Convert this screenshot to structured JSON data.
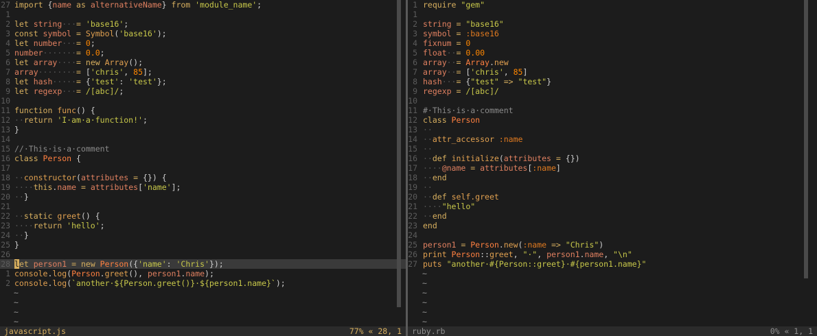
{
  "editor": {
    "left_pane": {
      "file_name": "javascript.js",
      "position": "77% « 28, 1"
    },
    "right_pane": {
      "file_name": "ruby.rb",
      "position": "0% « 1, 1"
    },
    "colors": {
      "background": "#1c1c1c",
      "statusline": "#2b2b2b",
      "keyword": "#d7af5f",
      "string": "#c8c84a",
      "number": "#ff8700",
      "comment": "#8a8a8a",
      "line_number": "#5c5c5c"
    }
  },
  "js_lines": [
    {
      "n": "27",
      "tokens": [
        [
          "kw",
          "import "
        ],
        [
          "pl",
          "{"
        ],
        [
          "id",
          "name "
        ],
        [
          "kw",
          "as "
        ],
        [
          "id",
          "alternativeName"
        ],
        [
          "pl",
          "} "
        ],
        [
          "kw",
          "from "
        ],
        [
          "str",
          "'module_name'"
        ],
        [
          "pl",
          ";"
        ]
      ]
    },
    {
      "n": "1",
      "tokens": []
    },
    {
      "n": "2",
      "tokens": [
        [
          "kw",
          "let "
        ],
        [
          "id",
          "string"
        ],
        [
          "ws",
          "···"
        ],
        [
          "op",
          "= "
        ],
        [
          "str",
          "'base16'"
        ],
        [
          "pl",
          ";"
        ]
      ]
    },
    {
      "n": "3",
      "tokens": [
        [
          "kw",
          "const "
        ],
        [
          "id",
          "symbol "
        ],
        [
          "op",
          "= "
        ],
        [
          "fn",
          "Symbol"
        ],
        [
          "pl",
          "("
        ],
        [
          "str",
          "'base16'"
        ],
        [
          "pl",
          ");"
        ]
      ]
    },
    {
      "n": "4",
      "tokens": [
        [
          "kw",
          "let "
        ],
        [
          "id",
          "number"
        ],
        [
          "ws",
          "···"
        ],
        [
          "op",
          "= "
        ],
        [
          "num",
          "0"
        ],
        [
          "pl",
          ";"
        ]
      ]
    },
    {
      "n": "5",
      "tokens": [
        [
          "id",
          "number"
        ],
        [
          "ws",
          "·······"
        ],
        [
          "op",
          "= "
        ],
        [
          "num",
          "0.0"
        ],
        [
          "pl",
          ";"
        ]
      ]
    },
    {
      "n": "6",
      "tokens": [
        [
          "kw",
          "let "
        ],
        [
          "id",
          "array"
        ],
        [
          "ws",
          "····"
        ],
        [
          "op",
          "= "
        ],
        [
          "kw",
          "new "
        ],
        [
          "fn",
          "Array"
        ],
        [
          "pl",
          "();"
        ]
      ]
    },
    {
      "n": "7",
      "tokens": [
        [
          "id",
          "array"
        ],
        [
          "ws",
          "········"
        ],
        [
          "op",
          "= "
        ],
        [
          "pl",
          "["
        ],
        [
          "str",
          "'chris'"
        ],
        [
          "pl",
          ", "
        ],
        [
          "num",
          "85"
        ],
        [
          "pl",
          "];"
        ]
      ]
    },
    {
      "n": "8",
      "tokens": [
        [
          "kw",
          "let "
        ],
        [
          "id",
          "hash"
        ],
        [
          "ws",
          "·····"
        ],
        [
          "op",
          "= "
        ],
        [
          "pl",
          "{"
        ],
        [
          "str",
          "'test'"
        ],
        [
          "pl",
          ": "
        ],
        [
          "str",
          "'test'"
        ],
        [
          "pl",
          "};"
        ]
      ]
    },
    {
      "n": "9",
      "tokens": [
        [
          "kw",
          "let "
        ],
        [
          "id",
          "regexp"
        ],
        [
          "ws",
          "···"
        ],
        [
          "op",
          "= "
        ],
        [
          "str",
          "/[abc]/"
        ],
        [
          "pl",
          ";"
        ]
      ]
    },
    {
      "n": "10",
      "tokens": []
    },
    {
      "n": "11",
      "tokens": [
        [
          "kw",
          "function "
        ],
        [
          "fn",
          "func"
        ],
        [
          "pl",
          "() {"
        ]
      ]
    },
    {
      "n": "12",
      "tokens": [
        [
          "ws",
          "··"
        ],
        [
          "kw",
          "return "
        ],
        [
          "str",
          "'I·am·a·function!'"
        ],
        [
          "pl",
          ";"
        ]
      ]
    },
    {
      "n": "13",
      "tokens": [
        [
          "pl",
          "}"
        ]
      ]
    },
    {
      "n": "14",
      "tokens": []
    },
    {
      "n": "15",
      "tokens": [
        [
          "cmt",
          "//·This·is·a·comment"
        ]
      ]
    },
    {
      "n": "16",
      "tokens": [
        [
          "kw",
          "class "
        ],
        [
          "cls",
          "Person "
        ],
        [
          "pl",
          "{"
        ]
      ]
    },
    {
      "n": "17",
      "tokens": []
    },
    {
      "n": "18",
      "tokens": [
        [
          "ws",
          "··"
        ],
        [
          "fn",
          "constructor"
        ],
        [
          "pl",
          "("
        ],
        [
          "id",
          "attributes "
        ],
        [
          "op",
          "= "
        ],
        [
          "pl",
          "{}) {"
        ]
      ]
    },
    {
      "n": "19",
      "tokens": [
        [
          "ws",
          "····"
        ],
        [
          "kw",
          "this"
        ],
        [
          "pl",
          "."
        ],
        [
          "id",
          "name "
        ],
        [
          "op",
          "= "
        ],
        [
          "id",
          "attributes"
        ],
        [
          "pl",
          "["
        ],
        [
          "str",
          "'name'"
        ],
        [
          "pl",
          "];"
        ]
      ]
    },
    {
      "n": "20",
      "tokens": [
        [
          "ws",
          "··"
        ],
        [
          "pl",
          "}"
        ]
      ]
    },
    {
      "n": "21",
      "tokens": []
    },
    {
      "n": "22",
      "tokens": [
        [
          "ws",
          "··"
        ],
        [
          "kw",
          "static "
        ],
        [
          "fn",
          "greet"
        ],
        [
          "pl",
          "() {"
        ]
      ]
    },
    {
      "n": "23",
      "tokens": [
        [
          "ws",
          "····"
        ],
        [
          "kw",
          "return "
        ],
        [
          "str",
          "'hello'"
        ],
        [
          "pl",
          ";"
        ]
      ]
    },
    {
      "n": "24",
      "tokens": [
        [
          "ws",
          "··"
        ],
        [
          "pl",
          "}"
        ]
      ]
    },
    {
      "n": "25",
      "tokens": [
        [
          "pl",
          "}"
        ]
      ]
    },
    {
      "n": "26",
      "tokens": []
    },
    {
      "n": "28",
      "current": true,
      "tokens": [
        [
          "cur",
          "l"
        ],
        [
          "kw",
          "et "
        ],
        [
          "id",
          "person1 "
        ],
        [
          "op",
          "= "
        ],
        [
          "kw",
          "new "
        ],
        [
          "cls",
          "Person"
        ],
        [
          "pl",
          "({"
        ],
        [
          "str",
          "'name'"
        ],
        [
          "pl",
          ": "
        ],
        [
          "str",
          "'Chris'"
        ],
        [
          "pl",
          "});"
        ]
      ]
    },
    {
      "n": "1",
      "tokens": [
        [
          "fn",
          "console"
        ],
        [
          "pl",
          "."
        ],
        [
          "fn",
          "log"
        ],
        [
          "pl",
          "("
        ],
        [
          "cls",
          "Person"
        ],
        [
          "pl",
          "."
        ],
        [
          "fn",
          "greet"
        ],
        [
          "pl",
          "(), "
        ],
        [
          "id",
          "person1"
        ],
        [
          "pl",
          "."
        ],
        [
          "id",
          "name"
        ],
        [
          "pl",
          ");"
        ]
      ]
    },
    {
      "n": "2",
      "tokens": [
        [
          "fn",
          "console"
        ],
        [
          "pl",
          "."
        ],
        [
          "fn",
          "log"
        ],
        [
          "pl",
          "("
        ],
        [
          "str",
          "`another·${Person.greet()}·${person1.name}`"
        ],
        [
          "pl",
          ");"
        ]
      ]
    }
  ],
  "js_tildes": 4,
  "rb_lines": [
    {
      "n": "1",
      "tokens": [
        [
          "kw",
          "require "
        ],
        [
          "str",
          "\"gem\""
        ]
      ]
    },
    {
      "n": "1",
      "tokens": []
    },
    {
      "n": "2",
      "tokens": [
        [
          "id",
          "string "
        ],
        [
          "op",
          "= "
        ],
        [
          "str",
          "\"base16\""
        ]
      ]
    },
    {
      "n": "3",
      "tokens": [
        [
          "id",
          "symbol "
        ],
        [
          "op",
          "= "
        ],
        [
          "sym",
          ":base16"
        ]
      ]
    },
    {
      "n": "4",
      "tokens": [
        [
          "id",
          "fixnum "
        ],
        [
          "op",
          "= "
        ],
        [
          "num",
          "0"
        ]
      ]
    },
    {
      "n": "5",
      "tokens": [
        [
          "id",
          "float"
        ],
        [
          "ws",
          "··"
        ],
        [
          "op",
          "= "
        ],
        [
          "num",
          "0.00"
        ]
      ]
    },
    {
      "n": "6",
      "tokens": [
        [
          "id",
          "array"
        ],
        [
          "ws",
          "··"
        ],
        [
          "op",
          "= "
        ],
        [
          "cls",
          "Array"
        ],
        [
          "pl",
          "."
        ],
        [
          "fn",
          "new"
        ]
      ]
    },
    {
      "n": "7",
      "tokens": [
        [
          "id",
          "array"
        ],
        [
          "ws",
          "··"
        ],
        [
          "op",
          "= "
        ],
        [
          "pl",
          "["
        ],
        [
          "str",
          "'chris'"
        ],
        [
          "pl",
          ", "
        ],
        [
          "num",
          "85"
        ],
        [
          "pl",
          "]"
        ]
      ]
    },
    {
      "n": "8",
      "tokens": [
        [
          "id",
          "hash"
        ],
        [
          "ws",
          "···"
        ],
        [
          "op",
          "= "
        ],
        [
          "pl",
          "{"
        ],
        [
          "str",
          "\"test\" "
        ],
        [
          "op",
          "=> "
        ],
        [
          "str",
          "\"test\""
        ],
        [
          "pl",
          "}"
        ]
      ]
    },
    {
      "n": "9",
      "tokens": [
        [
          "id",
          "regexp "
        ],
        [
          "op",
          "= "
        ],
        [
          "str",
          "/[abc]/"
        ]
      ]
    },
    {
      "n": "10",
      "tokens": []
    },
    {
      "n": "11",
      "tokens": [
        [
          "cmt",
          "#·This·is·a·comment"
        ]
      ]
    },
    {
      "n": "12",
      "tokens": [
        [
          "kw",
          "class "
        ],
        [
          "cls",
          "Person"
        ]
      ]
    },
    {
      "n": "13",
      "tokens": [
        [
          "ws",
          "··"
        ]
      ]
    },
    {
      "n": "14",
      "tokens": [
        [
          "ws",
          "··"
        ],
        [
          "fn",
          "attr_accessor "
        ],
        [
          "sym",
          ":name"
        ]
      ]
    },
    {
      "n": "15",
      "tokens": [
        [
          "ws",
          "··"
        ]
      ]
    },
    {
      "n": "16",
      "tokens": [
        [
          "ws",
          "··"
        ],
        [
          "kw",
          "def "
        ],
        [
          "fn",
          "initialize"
        ],
        [
          "pl",
          "("
        ],
        [
          "id",
          "attributes "
        ],
        [
          "op",
          "= "
        ],
        [
          "pl",
          "{})"
        ]
      ]
    },
    {
      "n": "17",
      "tokens": [
        [
          "ws",
          "····"
        ],
        [
          "id",
          "@name "
        ],
        [
          "op",
          "= "
        ],
        [
          "id",
          "attributes"
        ],
        [
          "pl",
          "["
        ],
        [
          "sym",
          ":name"
        ],
        [
          "pl",
          "]"
        ]
      ]
    },
    {
      "n": "18",
      "tokens": [
        [
          "ws",
          "··"
        ],
        [
          "kw",
          "end"
        ]
      ]
    },
    {
      "n": "19",
      "tokens": [
        [
          "ws",
          "··"
        ]
      ]
    },
    {
      "n": "20",
      "tokens": [
        [
          "ws",
          "··"
        ],
        [
          "kw",
          "def "
        ],
        [
          "fn",
          "self.greet"
        ]
      ]
    },
    {
      "n": "21",
      "tokens": [
        [
          "ws",
          "····"
        ],
        [
          "str",
          "\"hello\""
        ]
      ]
    },
    {
      "n": "22",
      "tokens": [
        [
          "ws",
          "··"
        ],
        [
          "kw",
          "end"
        ]
      ]
    },
    {
      "n": "23",
      "tokens": [
        [
          "kw",
          "end"
        ]
      ]
    },
    {
      "n": "24",
      "tokens": []
    },
    {
      "n": "25",
      "tokens": [
        [
          "id",
          "person1 "
        ],
        [
          "op",
          "= "
        ],
        [
          "cls",
          "Person"
        ],
        [
          "pl",
          "."
        ],
        [
          "fn",
          "new"
        ],
        [
          "pl",
          "("
        ],
        [
          "sym",
          ":name "
        ],
        [
          "op",
          "=> "
        ],
        [
          "str",
          "\"Chris\""
        ],
        [
          "pl",
          ")"
        ]
      ]
    },
    {
      "n": "26",
      "tokens": [
        [
          "fn",
          "print "
        ],
        [
          "cls",
          "Person"
        ],
        [
          "pl",
          "::"
        ],
        [
          "fn",
          "greet"
        ],
        [
          "pl",
          ", "
        ],
        [
          "str",
          "\"·\""
        ],
        [
          "pl",
          ", "
        ],
        [
          "id",
          "person1"
        ],
        [
          "pl",
          "."
        ],
        [
          "id",
          "name"
        ],
        [
          "pl",
          ", "
        ],
        [
          "str",
          "\"\\n\""
        ]
      ]
    },
    {
      "n": "27",
      "tokens": [
        [
          "fn",
          "puts "
        ],
        [
          "str",
          "\"another·#{Person::greet}·#{person1.name}\""
        ]
      ]
    }
  ],
  "rb_tildes": 6
}
